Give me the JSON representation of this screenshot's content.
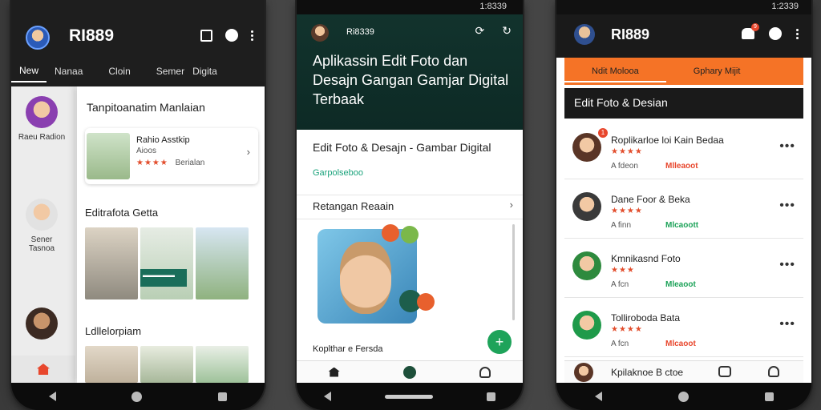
{
  "phone1": {
    "title": "RI889",
    "tabs": [
      "New",
      "Nanaa",
      "Cloin",
      "Semer",
      "Digita"
    ],
    "sidebar": [
      {
        "label": "Raeu Radion"
      },
      {
        "label": "Sener Tasnoa"
      }
    ],
    "panel_title": "Tanpitoanatim Manlaian",
    "card": {
      "name": "Rahio Asstkip",
      "sub": "Aioos",
      "rating_text": "Berialan",
      "stars": "★★★★"
    },
    "section1": "Editrafota Getta",
    "badge_caption": "▬▬▬▬▬",
    "section2": "Ldllelorpiam",
    "colors": {
      "accent": "#e8472d"
    }
  },
  "phone2": {
    "status_time": "1:8339",
    "brand": "Ri8339",
    "headline": "Aplikassin Edit Foto dan Desajn Gangan Gamjar Digital Terbaak",
    "edit_title": "Edit Foto & Desajn - Gambar Digital",
    "edit_link": "Garpolseboo",
    "section": "Retangan Reaain",
    "bottom_label": "Koplthar e Fersda",
    "fab": "+",
    "colors": {
      "hero": "#12332d",
      "accent": "#1ea35a"
    }
  },
  "phone3": {
    "status_time": "1:2339",
    "title": "RI889",
    "bell_count": "9",
    "tabs": [
      "Ndit Molooa",
      "Gphary Mijit"
    ],
    "section": "Edit Foto & Desian",
    "items": [
      {
        "name": "Roplikarloe loi Kain Bedaa",
        "stars": "★★★★",
        "meta": "A fdeon",
        "tag": "Mlleaoot",
        "tag_color": "#e8472d",
        "more": "•••",
        "badge": "1"
      },
      {
        "name": "Dane Foor & Beka",
        "stars": "★★★★",
        "meta": "A finn",
        "tag": "Mlcaoott",
        "tag_color": "#1ea35a",
        "more": "•••",
        "badge": ""
      },
      {
        "name": "Kmnikasnd Foto",
        "stars": "★★★",
        "meta": "A fcn",
        "tag": "Mleaoot",
        "tag_color": "#1ea35a",
        "more": "•••",
        "badge": ""
      },
      {
        "name": "Tolliroboda Bata",
        "stars": "★★★★",
        "meta": "A fcn",
        "tag": "Mlcaoot",
        "tag_color": "#e8472d",
        "more": "•••",
        "badge": ""
      },
      {
        "name": "Kpilaknoe B ctoe",
        "stars": "",
        "meta": "",
        "tag": "",
        "tag_color": "#e8472d",
        "more": "",
        "badge": ""
      }
    ],
    "colors": {
      "tabs": "#f57326",
      "accent": "#e8472d"
    }
  }
}
